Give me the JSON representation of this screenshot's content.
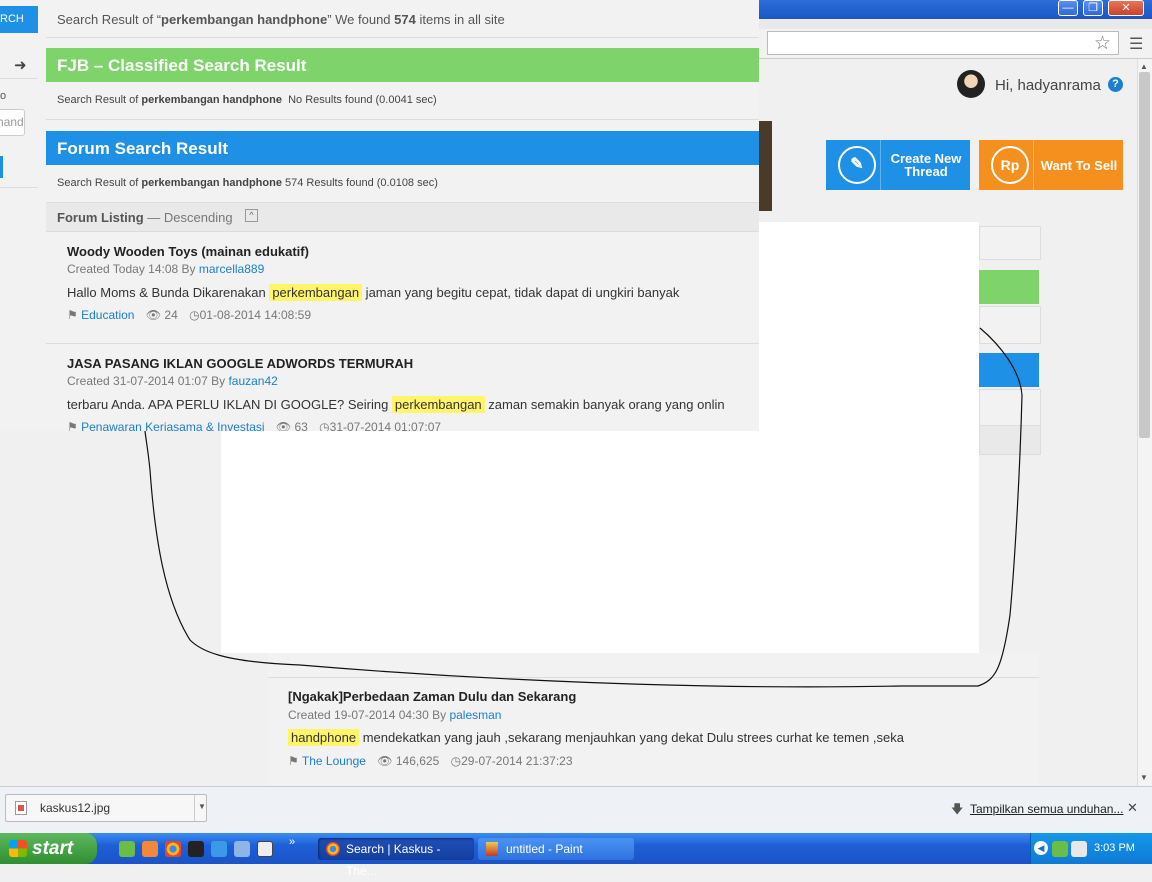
{
  "browser": {
    "window_buttons": [
      "minimize",
      "restore",
      "close"
    ],
    "nav_forward_icon": "arrow-right-icon",
    "left_partial_button": "RCH",
    "left_partial_label": "o",
    "left_partial_input": "hand",
    "bookmark_icon": "star-icon",
    "menu_icon": "hamburger-icon"
  },
  "header": {
    "greeting": "Hi, hadyanrama",
    "help_icon": "?",
    "create_thread": "Create New Thread",
    "want_to_sell": "Want To Sell",
    "create_thread_icon": "pencil-icon",
    "want_to_sell_icon": "Rp",
    "colors": {
      "blue": "#1e90e6",
      "orange": "#f5901e",
      "green": "#7ed36b"
    }
  },
  "search": {
    "summary_prefix": "Search Result of “",
    "query": "perkembangan handphone",
    "summary_mid": "” We found ",
    "count": "574",
    "summary_suffix": " items in all site"
  },
  "fjb": {
    "title": "FJB – Classified Search Result",
    "result_prefix": "Search Result of ",
    "query": "perkembangan handphone",
    "result_suffix": "No Results found (0.0041 sec)"
  },
  "forum": {
    "title": "Forum Search Result",
    "result_prefix": "Search Result of ",
    "query": "perkembangan handphone",
    "result_suffix": "574 Results found (0.0108 sec)",
    "listing_label": "Forum Listing",
    "listing_order": "— Descending",
    "sort_icon": "chevron-up-icon"
  },
  "threads": [
    {
      "title": "Woody Wooden Toys (mainan edukatif)",
      "created": "Created Today 14:08 By ",
      "author": "marcella889",
      "snippet_before": "Hallo Moms & Bunda Dikarenakan ",
      "highlight": "perkembangan",
      "snippet_after": " jaman yang begitu cepat, tidak dapat di ungkiri banyak",
      "category": "Education",
      "views": "24",
      "date": "01-08-2014 14:08:59"
    },
    {
      "title": "JASA PASANG IKLAN GOOGLE ADWORDS TERMURAH",
      "created": "Created 31-07-2014 01:07 By ",
      "author": "fauzan42",
      "snippet_before": "terbaru Anda. APA PERLU IKLAN DI GOOGLE? Seiring ",
      "highlight": "perkembangan",
      "snippet_after": " zaman semakin banyak orang yang onlin",
      "category": "Penawaran Kerjasama & Investasi",
      "views": "63",
      "date": "31-07-2014 01:07:07"
    },
    {
      "title": "[Ngakak]Perbedaan Zaman Dulu dan Sekarang",
      "created": "Created 19-07-2014 04:30 By ",
      "author": "palesman",
      "snippet_before": "",
      "highlight": "handphone",
      "snippet_after": " mendekatkan yang jauh ,sekarang menjauhkan yang dekat Dulu strees curhat ke temen ,seka",
      "category": "The Lounge",
      "views": "146,625",
      "date": "29-07-2014 21:37:23"
    }
  ],
  "download_bar": {
    "file": "kaskus12.jpg",
    "show_all": "Tampilkan semua unduhan...",
    "close_icon": "close-icon"
  },
  "taskbar": {
    "start": "start",
    "tasks": [
      "Search | Kaskus - The...",
      "untitled - Paint"
    ],
    "clock": "3:03 PM"
  }
}
